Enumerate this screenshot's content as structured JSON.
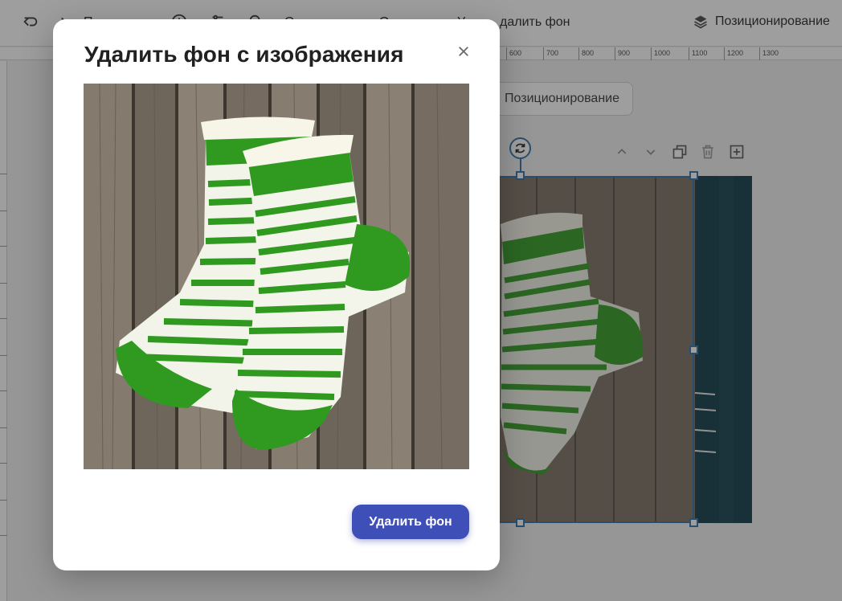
{
  "toolbar": {
    "undo_icon": "undo-icon",
    "redo_icon": "redo-icon",
    "item_1": "П",
    "item_2": "О",
    "item_3": "О",
    "item_4": "У",
    "remove_bg_label": "далить фон",
    "positioning_label": "Позиционирование"
  },
  "ruler": {
    "top_ticks": [
      "600",
      "700",
      "800",
      "900",
      "1000",
      "1100",
      "1200",
      "1300"
    ]
  },
  "canvas": {
    "positioning_button": "Позиционирование"
  },
  "modal": {
    "title": "Удалить фон с изображения",
    "close_icon": "close-icon",
    "preview_image": "knitted-socks-photo",
    "submit_label": "Удалить фон"
  },
  "colors": {
    "accent": "#3f4fb8",
    "selection": "#2f6da8",
    "sock_green": "#2f9a1f"
  }
}
